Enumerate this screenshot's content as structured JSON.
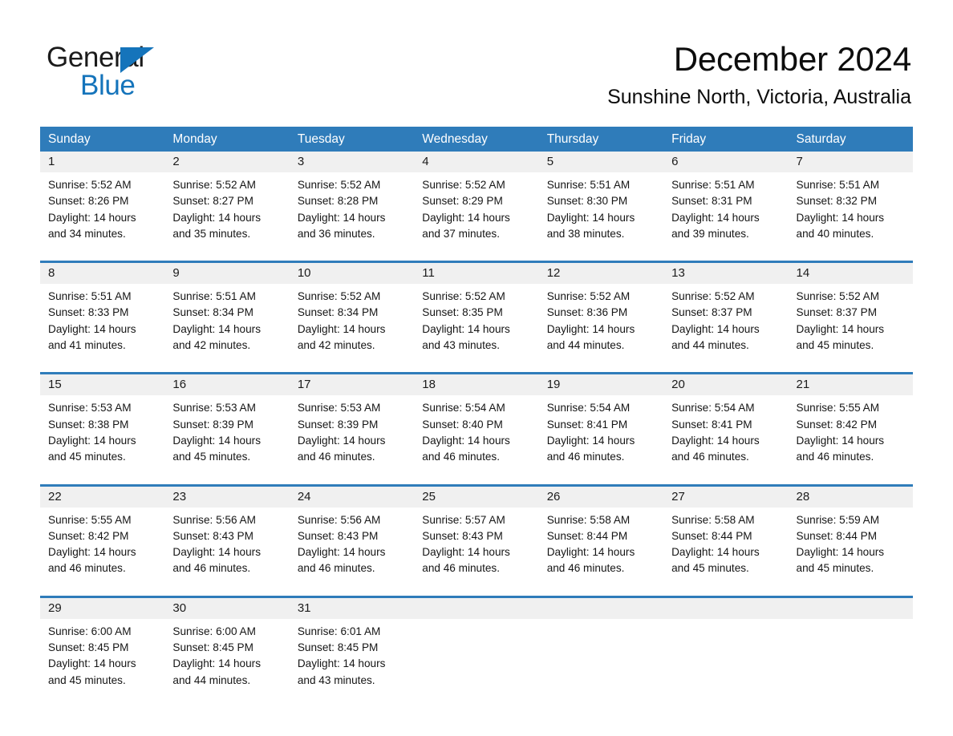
{
  "brand": {
    "name_part1": "General",
    "name_part2": "Blue",
    "accent_color": "#1574bb",
    "triangle_icon": "triangle-right-icon"
  },
  "header": {
    "month_title": "December 2024",
    "location": "Sunshine North, Victoria, Australia"
  },
  "theme": {
    "header_blue": "#2f7cba",
    "day_number_bg": "#f0f0f0",
    "text_color": "#151515"
  },
  "weekdays": [
    "Sunday",
    "Monday",
    "Tuesday",
    "Wednesday",
    "Thursday",
    "Friday",
    "Saturday"
  ],
  "weeks": [
    [
      {
        "day": "1",
        "info": "Sunrise: 5:52 AM\nSunset: 8:26 PM\nDaylight: 14 hours\nand 34 minutes."
      },
      {
        "day": "2",
        "info": "Sunrise: 5:52 AM\nSunset: 8:27 PM\nDaylight: 14 hours\nand 35 minutes."
      },
      {
        "day": "3",
        "info": "Sunrise: 5:52 AM\nSunset: 8:28 PM\nDaylight: 14 hours\nand 36 minutes."
      },
      {
        "day": "4",
        "info": "Sunrise: 5:52 AM\nSunset: 8:29 PM\nDaylight: 14 hours\nand 37 minutes."
      },
      {
        "day": "5",
        "info": "Sunrise: 5:51 AM\nSunset: 8:30 PM\nDaylight: 14 hours\nand 38 minutes."
      },
      {
        "day": "6",
        "info": "Sunrise: 5:51 AM\nSunset: 8:31 PM\nDaylight: 14 hours\nand 39 minutes."
      },
      {
        "day": "7",
        "info": "Sunrise: 5:51 AM\nSunset: 8:32 PM\nDaylight: 14 hours\nand 40 minutes."
      }
    ],
    [
      {
        "day": "8",
        "info": "Sunrise: 5:51 AM\nSunset: 8:33 PM\nDaylight: 14 hours\nand 41 minutes."
      },
      {
        "day": "9",
        "info": "Sunrise: 5:51 AM\nSunset: 8:34 PM\nDaylight: 14 hours\nand 42 minutes."
      },
      {
        "day": "10",
        "info": "Sunrise: 5:52 AM\nSunset: 8:34 PM\nDaylight: 14 hours\nand 42 minutes."
      },
      {
        "day": "11",
        "info": "Sunrise: 5:52 AM\nSunset: 8:35 PM\nDaylight: 14 hours\nand 43 minutes."
      },
      {
        "day": "12",
        "info": "Sunrise: 5:52 AM\nSunset: 8:36 PM\nDaylight: 14 hours\nand 44 minutes."
      },
      {
        "day": "13",
        "info": "Sunrise: 5:52 AM\nSunset: 8:37 PM\nDaylight: 14 hours\nand 44 minutes."
      },
      {
        "day": "14",
        "info": "Sunrise: 5:52 AM\nSunset: 8:37 PM\nDaylight: 14 hours\nand 45 minutes."
      }
    ],
    [
      {
        "day": "15",
        "info": "Sunrise: 5:53 AM\nSunset: 8:38 PM\nDaylight: 14 hours\nand 45 minutes."
      },
      {
        "day": "16",
        "info": "Sunrise: 5:53 AM\nSunset: 8:39 PM\nDaylight: 14 hours\nand 45 minutes."
      },
      {
        "day": "17",
        "info": "Sunrise: 5:53 AM\nSunset: 8:39 PM\nDaylight: 14 hours\nand 46 minutes."
      },
      {
        "day": "18",
        "info": "Sunrise: 5:54 AM\nSunset: 8:40 PM\nDaylight: 14 hours\nand 46 minutes."
      },
      {
        "day": "19",
        "info": "Sunrise: 5:54 AM\nSunset: 8:41 PM\nDaylight: 14 hours\nand 46 minutes."
      },
      {
        "day": "20",
        "info": "Sunrise: 5:54 AM\nSunset: 8:41 PM\nDaylight: 14 hours\nand 46 minutes."
      },
      {
        "day": "21",
        "info": "Sunrise: 5:55 AM\nSunset: 8:42 PM\nDaylight: 14 hours\nand 46 minutes."
      }
    ],
    [
      {
        "day": "22",
        "info": "Sunrise: 5:55 AM\nSunset: 8:42 PM\nDaylight: 14 hours\nand 46 minutes."
      },
      {
        "day": "23",
        "info": "Sunrise: 5:56 AM\nSunset: 8:43 PM\nDaylight: 14 hours\nand 46 minutes."
      },
      {
        "day": "24",
        "info": "Sunrise: 5:56 AM\nSunset: 8:43 PM\nDaylight: 14 hours\nand 46 minutes."
      },
      {
        "day": "25",
        "info": "Sunrise: 5:57 AM\nSunset: 8:43 PM\nDaylight: 14 hours\nand 46 minutes."
      },
      {
        "day": "26",
        "info": "Sunrise: 5:58 AM\nSunset: 8:44 PM\nDaylight: 14 hours\nand 46 minutes."
      },
      {
        "day": "27",
        "info": "Sunrise: 5:58 AM\nSunset: 8:44 PM\nDaylight: 14 hours\nand 45 minutes."
      },
      {
        "day": "28",
        "info": "Sunrise: 5:59 AM\nSunset: 8:44 PM\nDaylight: 14 hours\nand 45 minutes."
      }
    ],
    [
      {
        "day": "29",
        "info": "Sunrise: 6:00 AM\nSunset: 8:45 PM\nDaylight: 14 hours\nand 45 minutes."
      },
      {
        "day": "30",
        "info": "Sunrise: 6:00 AM\nSunset: 8:45 PM\nDaylight: 14 hours\nand 44 minutes."
      },
      {
        "day": "31",
        "info": "Sunrise: 6:01 AM\nSunset: 8:45 PM\nDaylight: 14 hours\nand 43 minutes."
      },
      {
        "day": "",
        "info": ""
      },
      {
        "day": "",
        "info": ""
      },
      {
        "day": "",
        "info": ""
      },
      {
        "day": "",
        "info": ""
      }
    ]
  ]
}
